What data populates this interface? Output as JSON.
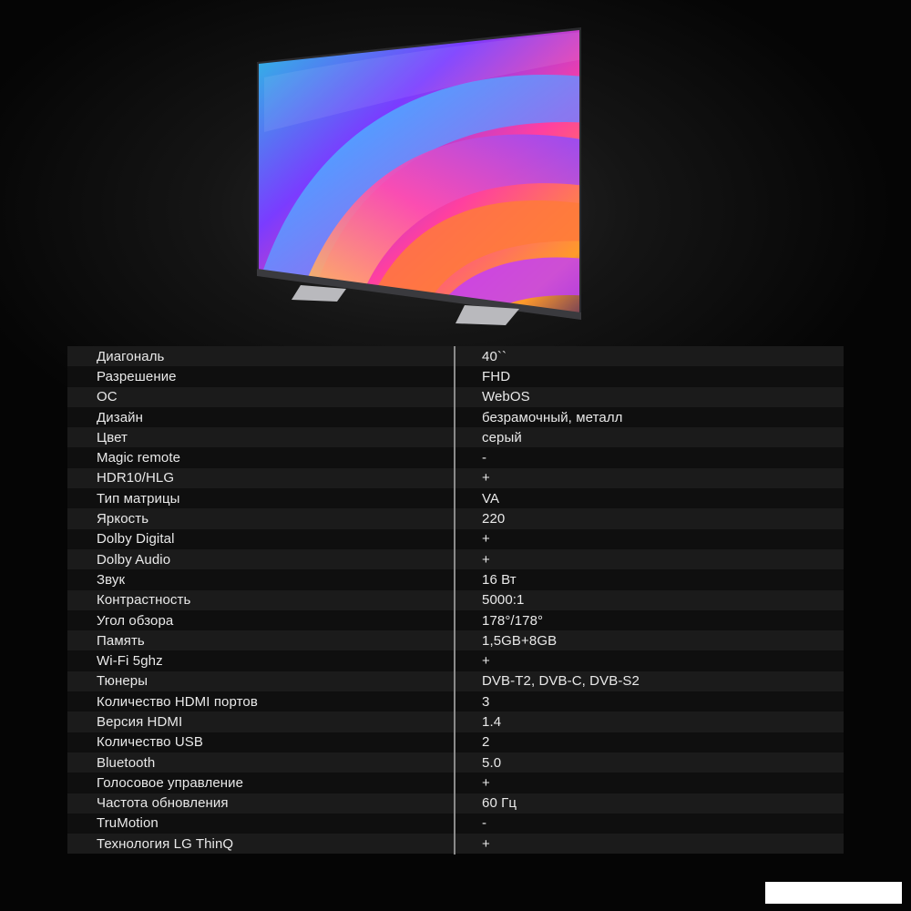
{
  "colors": {
    "background": "#000000",
    "row_odd": "#1b1b1b",
    "row_even": "#0f0f0f",
    "text": "#e9e9e9",
    "divider": "#8a8a8a"
  },
  "illustration": {
    "icon": "television-icon"
  },
  "specs": [
    {
      "label": "Диагональ",
      "value": "40``"
    },
    {
      "label": "Разрешение",
      "value": "FHD"
    },
    {
      "label": "ОС",
      "value": "WebOS"
    },
    {
      "label": "Дизайн",
      "value": "безрамочный, металл"
    },
    {
      "label": "Цвет",
      "value": "серый"
    },
    {
      "label": "Magic remote",
      "value": "-"
    },
    {
      "label": "HDR10/HLG",
      "value": "+"
    },
    {
      "label": "Тип матрицы",
      "value": "VA"
    },
    {
      "label": "Яркость",
      "value": "220"
    },
    {
      "label": "Dolby Digital",
      "value": "+"
    },
    {
      "label": "Dolby Audio",
      "value": "+"
    },
    {
      "label": "Звук",
      "value": "16 Вт"
    },
    {
      "label": "Контрастность",
      "value": "5000:1"
    },
    {
      "label": "Угол обзора",
      "value": "178°/178°"
    },
    {
      "label": "Память",
      "value": "1,5GB+8GB"
    },
    {
      "label": "Wi-Fi 5ghz",
      "value": "+"
    },
    {
      "label": "Тюнеры",
      "value": "DVB-T2, DVB-C, DVB-S2"
    },
    {
      "label": "Количество HDMI портов",
      "value": "3"
    },
    {
      "label": "Версия HDMI",
      "value": "1.4"
    },
    {
      "label": "Количество USB",
      "value": "2"
    },
    {
      "label": "Bluetooth",
      "value": "5.0"
    },
    {
      "label": "Голосовое управление",
      "value": "+"
    },
    {
      "label": "Частота обновления",
      "value": "60 Гц"
    },
    {
      "label": "TruMotion",
      "value": "-"
    },
    {
      "label": "Технология LG ThinQ",
      "value": "+"
    }
  ]
}
